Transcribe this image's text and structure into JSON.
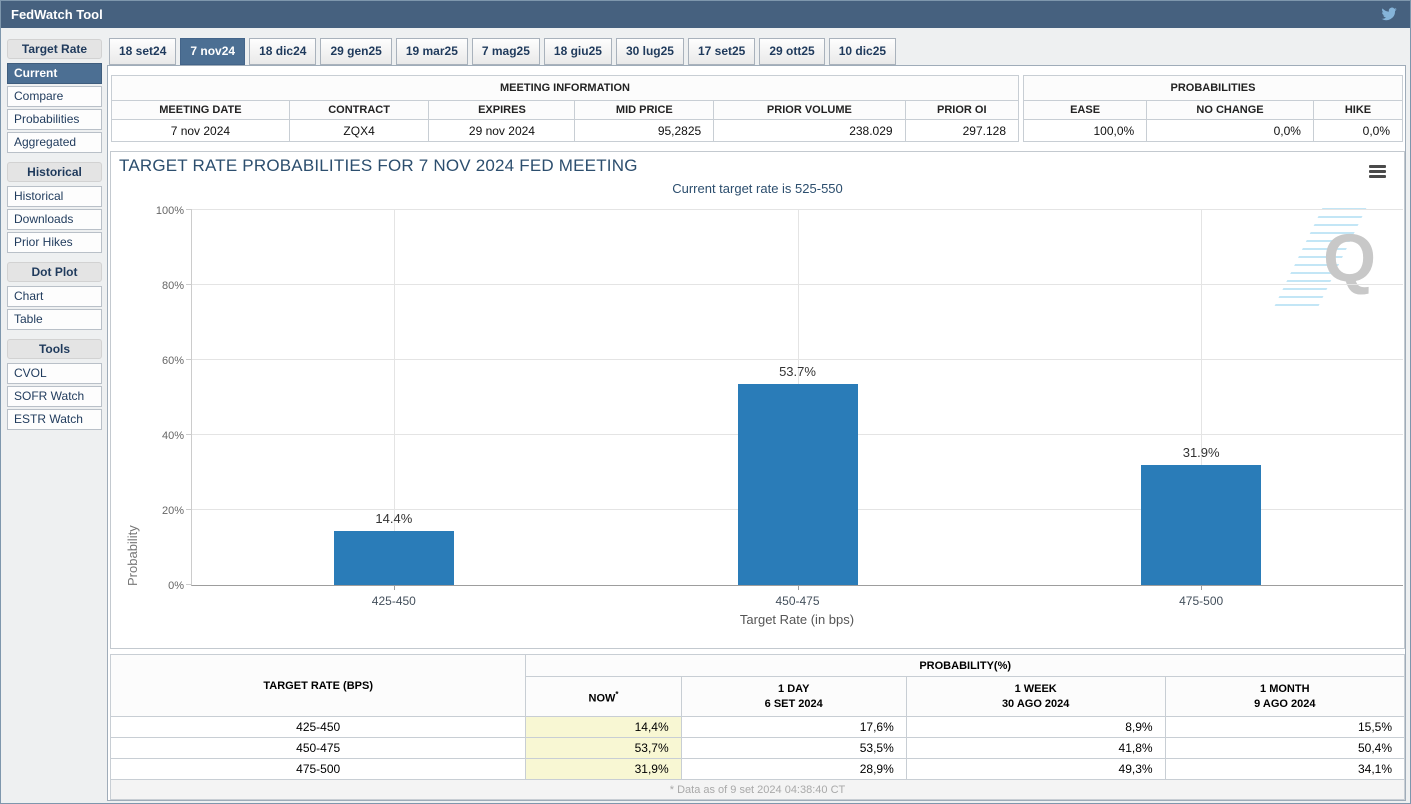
{
  "titlebar": {
    "title": "FedWatch Tool"
  },
  "tabs": {
    "selected_index": 1,
    "items": [
      "18 set24",
      "7 nov24",
      "18 dic24",
      "29 gen25",
      "19 mar25",
      "7 mag25",
      "18 giu25",
      "30 lug25",
      "17 set25",
      "29 ott25",
      "10 dic25"
    ]
  },
  "sidebar": {
    "sections": [
      {
        "header": "Target Rate",
        "items": [
          {
            "label": "Current",
            "selected": true
          },
          {
            "label": "Compare"
          },
          {
            "label": "Probabilities"
          },
          {
            "label": "Aggregated"
          }
        ]
      },
      {
        "header": "Historical",
        "items": [
          {
            "label": "Historical"
          },
          {
            "label": "Downloads"
          },
          {
            "label": "Prior Hikes"
          }
        ]
      },
      {
        "header": "Dot Plot",
        "items": [
          {
            "label": "Chart"
          },
          {
            "label": "Table"
          }
        ]
      },
      {
        "header": "Tools",
        "items": [
          {
            "label": "CVOL"
          },
          {
            "label": "SOFR Watch"
          },
          {
            "label": "ESTR Watch"
          }
        ]
      }
    ]
  },
  "meeting_info": {
    "title": "MEETING INFORMATION",
    "columns": [
      "MEETING DATE",
      "CONTRACT",
      "EXPIRES",
      "MID PRICE",
      "PRIOR VOLUME",
      "PRIOR OI"
    ],
    "values": [
      "7 nov 2024",
      "ZQX4",
      "29 nov 2024",
      "95,2825",
      "238.029",
      "297.128"
    ]
  },
  "probabilities_summary": {
    "title": "PROBABILITIES",
    "columns": [
      "EASE",
      "NO CHANGE",
      "HIKE"
    ],
    "values": [
      "100,0%",
      "0,0%",
      "0,0%"
    ]
  },
  "chart_data": {
    "type": "bar",
    "title": "TARGET RATE PROBABILITIES FOR 7 NOV 2024 FED MEETING",
    "subtitle": "Current target rate is 525-550",
    "categories": [
      "425-450",
      "450-475",
      "475-500"
    ],
    "values": [
      14.4,
      53.7,
      31.9
    ],
    "value_labels": [
      "14.4%",
      "53.7%",
      "31.9%"
    ],
    "xlabel": "Target Rate (in bps)",
    "ylabel": "Probability",
    "ylim": [
      0,
      100
    ],
    "yticks": [
      0,
      20,
      40,
      60,
      80,
      100
    ],
    "ytick_labels": [
      "0%",
      "20%",
      "40%",
      "60%",
      "80%",
      "100%"
    ],
    "grid": true,
    "legend": "none",
    "bar_color": "#2a7cb8",
    "watermark_letter": "Q"
  },
  "bottom_table": {
    "col1_header": "TARGET RATE (BPS)",
    "group_header": "PROBABILITY(%)",
    "now_label": "NOW",
    "now_asterisk": "*",
    "history_columns": [
      {
        "line1": "1 DAY",
        "line2": "6 SET 2024"
      },
      {
        "line1": "1 WEEK",
        "line2": "30 AGO 2024"
      },
      {
        "line1": "1 MONTH",
        "line2": "9 AGO 2024"
      }
    ],
    "rows": [
      {
        "range": "425-450",
        "now": "14,4%",
        "day": "17,6%",
        "week": "8,9%",
        "month": "15,5%"
      },
      {
        "range": "450-475",
        "now": "53,7%",
        "day": "53,5%",
        "week": "41,8%",
        "month": "50,4%"
      },
      {
        "range": "475-500",
        "now": "31,9%",
        "day": "28,9%",
        "week": "49,3%",
        "month": "34,1%"
      }
    ],
    "footnote": "* Data as of 9 set 2024 04:38:40 CT"
  },
  "colors": {
    "titlebar_bg": "#46617f",
    "selected_bg": "#4c6f93",
    "bar": "#2a7cb8",
    "now_highlight": "#f8f7d3",
    "twitter_blue": "#85b4d9"
  }
}
